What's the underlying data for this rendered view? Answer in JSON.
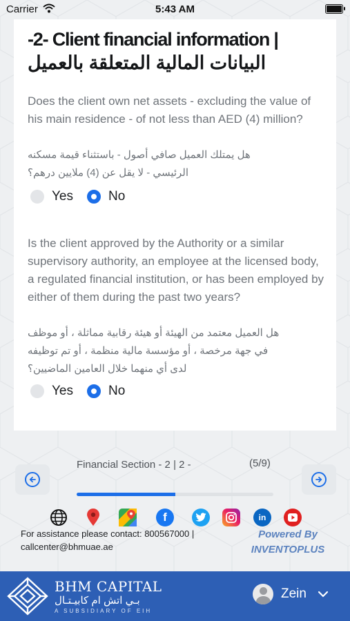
{
  "status_bar": {
    "carrier": "Carrier",
    "time": "5:43 AM"
  },
  "card": {
    "title_en": "-2- Client financial information |",
    "title_ar": "البيانات المالية المتعلقة بالعميل",
    "questions": [
      {
        "text_en": "Does the client own net assets - excluding the value of his main residence - of not less than AED (4) million?",
        "text_ar_lines": [
          "هل يمتلك العميل صافي أصول - باستثناء قيمة مسكنه",
          "الرئيسي - لا يقل عن (4) ملايين درهم؟"
        ],
        "options": [
          "Yes",
          "No"
        ],
        "selected": "No"
      },
      {
        "text_en": "Is the client approved by the Authority or a similar supervisory authority, an employee at the licensed body, a regulated financial institution, or has been employed by either of them during the past two years?",
        "text_ar_lines": [
          "هل العميل معتمد من الهيئة أو هيئة رقابية مماثلة ، أو موظف",
          "في جهة مرخصة ، أو مؤسسة مالية منظمة ، أو تم توظيفه",
          "لدى أي منهما خلال العامين الماضيين؟"
        ],
        "options": [
          "Yes",
          "No"
        ],
        "selected": "No"
      }
    ]
  },
  "navigation": {
    "section_label": "Financial Section - 2 | 2 -",
    "progress_text": "(5/9)",
    "progress_fraction": 0.5,
    "prev_icon": "arrow-left-circle-icon",
    "next_icon": "arrow-right-circle-icon"
  },
  "social_icons": [
    "globe-icon",
    "map-pin-icon",
    "google-maps-icon",
    "facebook-icon",
    "twitter-icon",
    "instagram-icon",
    "linkedin-icon",
    "youtube-icon"
  ],
  "contact": {
    "text": "For assistance please contact: 800567000 | callcenter@bhmuae.ae"
  },
  "powered": {
    "line1": "Powered By",
    "line2": "INVENTOPLUS"
  },
  "footer": {
    "brand_en": "BHM CAPITAL",
    "brand_ar": "بـي اتش ام كابيـتـال",
    "brand_sub": "A SUBSIDIARY OF EIH",
    "user_name": "Zein"
  },
  "colors": {
    "accent": "#1c6ee8",
    "footer": "#2d5fb5",
    "powered": "#5c83bf"
  }
}
